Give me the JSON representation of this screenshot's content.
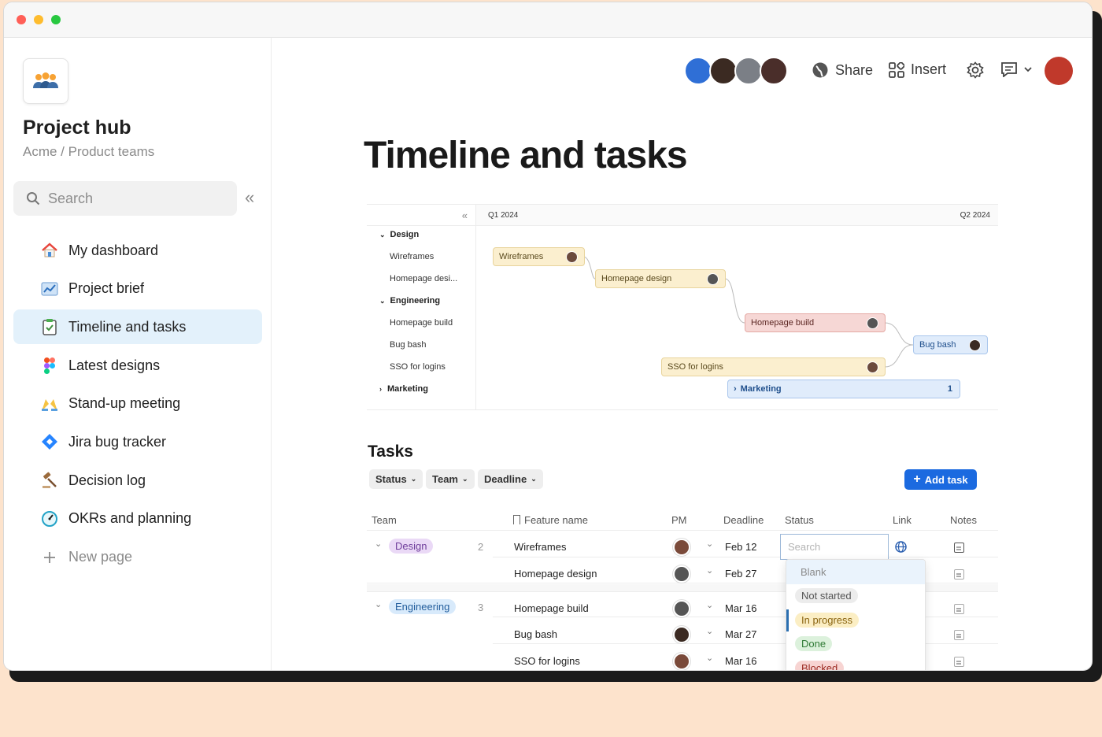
{
  "sidebar": {
    "hub_title": "Project hub",
    "hub_crumb": "Acme / Product teams",
    "search_placeholder": "Search",
    "items": [
      {
        "label": "My dashboard",
        "icon": "house-icon"
      },
      {
        "label": "Project brief",
        "icon": "chart-icon"
      },
      {
        "label": "Timeline and tasks",
        "icon": "clipboard-check-icon",
        "active": true
      },
      {
        "label": "Latest designs",
        "icon": "figma-icon"
      },
      {
        "label": "Stand-up meeting",
        "icon": "raised-hands-icon"
      },
      {
        "label": "Jira bug tracker",
        "icon": "jira-icon"
      },
      {
        "label": "Decision log",
        "icon": "gavel-icon"
      },
      {
        "label": "OKRs and planning",
        "icon": "target-icon"
      },
      {
        "label": "New page",
        "icon": "plus-icon"
      }
    ]
  },
  "header": {
    "share_label": "Share",
    "insert_label": "Insert"
  },
  "page": {
    "title": "Timeline and tasks"
  },
  "gantt": {
    "q1": "Q1 2024",
    "q2": "Q2 2024",
    "outline": [
      {
        "label": "Design",
        "group": true
      },
      {
        "label": "Wireframes"
      },
      {
        "label": "Homepage desi..."
      },
      {
        "label": "Engineering",
        "group": true
      },
      {
        "label": "Homepage build"
      },
      {
        "label": "Bug bash"
      },
      {
        "label": "SSO for logins"
      },
      {
        "label": "Marketing",
        "group": true
      }
    ],
    "bars": {
      "wireframes": "Wireframes",
      "homepage_design": "Homepage design",
      "homepage_build": "Homepage build",
      "bug_bash": "Bug bash",
      "sso": "SSO for logins",
      "marketing": "Marketing",
      "marketing_count": "1"
    }
  },
  "tasks": {
    "title": "Tasks",
    "filters": [
      "Status",
      "Team",
      "Deadline"
    ],
    "add_label": "Add task",
    "columns": {
      "team": "Team",
      "feature": "Feature name",
      "pm": "PM",
      "deadline": "Deadline",
      "status": "Status",
      "link": "Link",
      "notes": "Notes"
    },
    "groups": [
      {
        "team": "Design",
        "count": "2",
        "color": "#ead9f6",
        "text_color": "#6f3d9b"
      },
      {
        "team": "Engineering",
        "count": "3",
        "color": "#d8eafb",
        "text_color": "#225d9c"
      }
    ],
    "rows": [
      {
        "feature": "Wireframes",
        "deadline": "Feb 12"
      },
      {
        "feature": "Homepage design",
        "deadline": "Feb 27"
      },
      {
        "feature": "Homepage build",
        "deadline": "Mar 16"
      },
      {
        "feature": "Bug bash",
        "deadline": "Mar 27"
      },
      {
        "feature": "SSO for logins",
        "deadline": "Mar 16"
      }
    ],
    "status_search_placeholder": "Search",
    "status_options": [
      {
        "label": "Blank",
        "bg": "transparent",
        "fg": "#8a8a8a"
      },
      {
        "label": "Not started",
        "bg": "#ececec",
        "fg": "#555555"
      },
      {
        "label": "In progress",
        "bg": "#fbeec4",
        "fg": "#8a6410"
      },
      {
        "label": "Done",
        "bg": "#dcf1dc",
        "fg": "#2f7a35"
      },
      {
        "label": "Blocked",
        "bg": "#f7d4d2",
        "fg": "#9b2a22"
      }
    ]
  }
}
